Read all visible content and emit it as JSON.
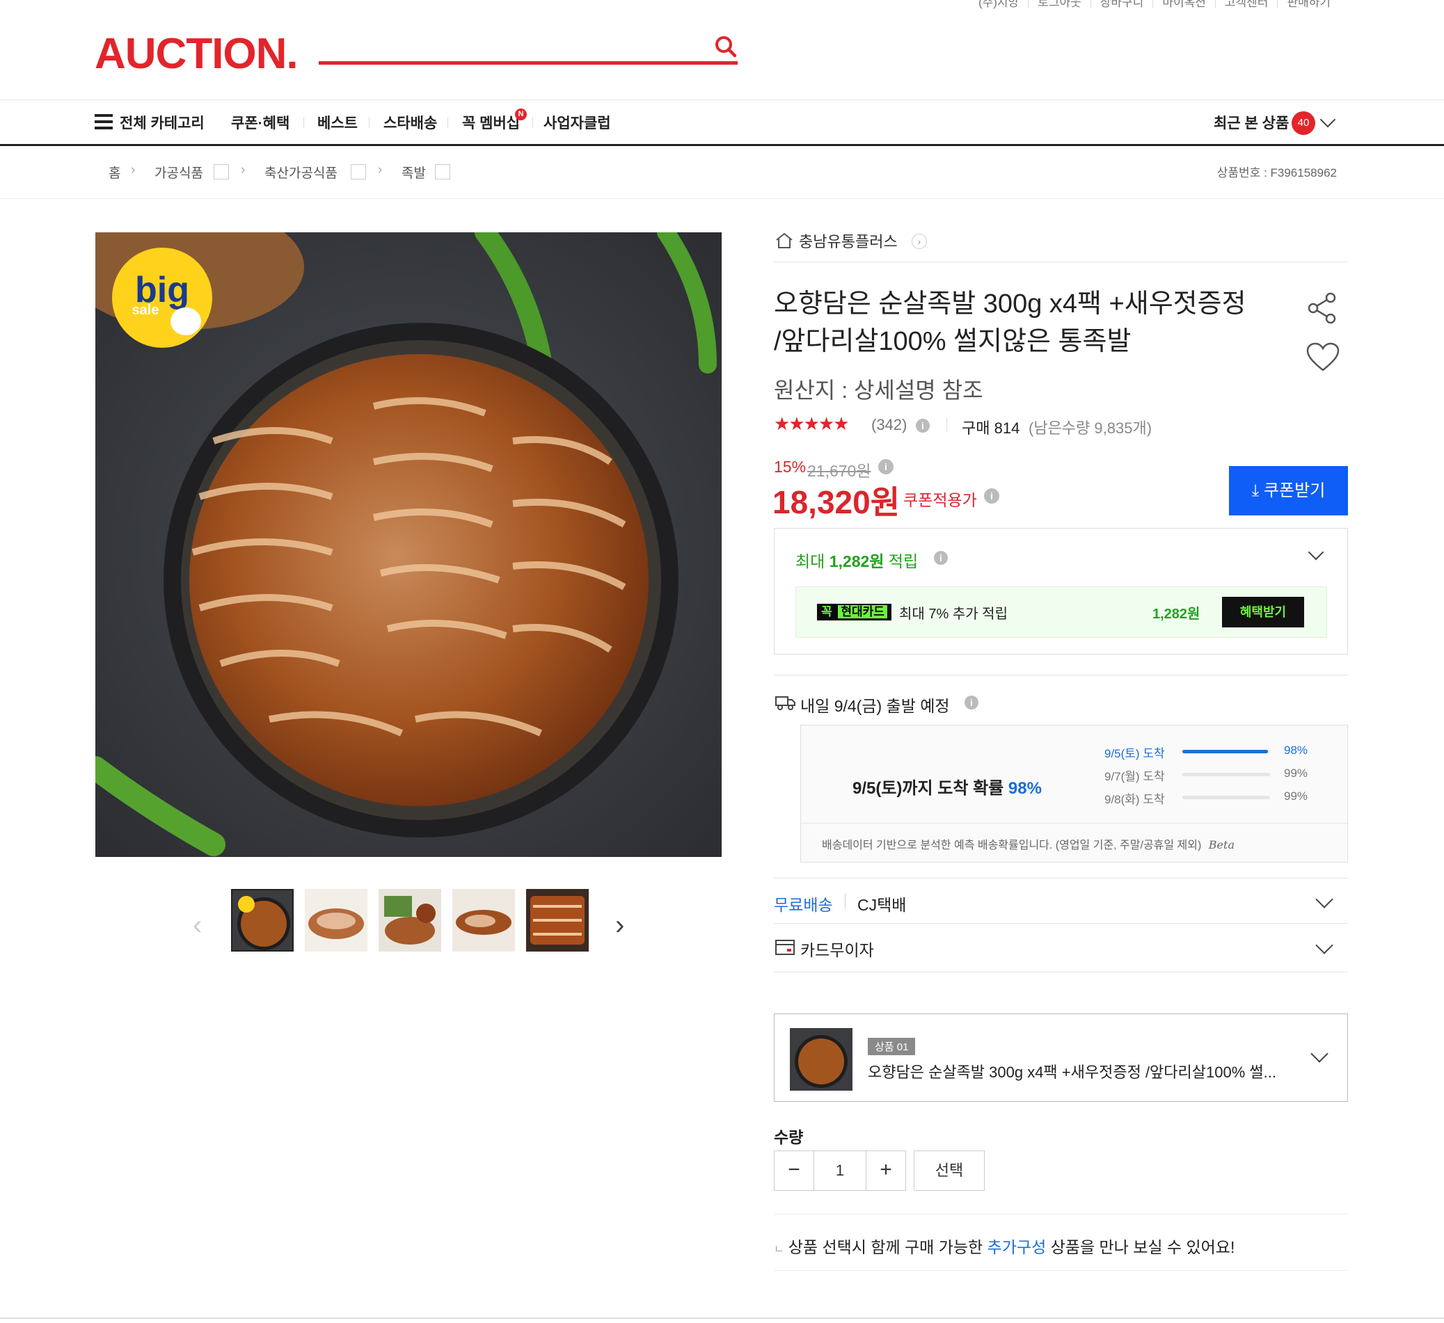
{
  "util_links": [
    "(주)지앙",
    "로그아웃",
    "장바구니",
    "마이옥션",
    "고객센터",
    "판매하기"
  ],
  "logo": "AUCTION.",
  "gnb": {
    "all_category": "전체 카테고리",
    "items": [
      "쿠폰·혜택",
      "베스트",
      "스타배송",
      "꼭 멤버십",
      "사업자클럽"
    ],
    "membership_badge": "N",
    "recent_label": "최근 본 상품",
    "recent_count": "40"
  },
  "breadcrumb": {
    "home": "홈",
    "levels": [
      "가공식품",
      "축산가공식품",
      "족발"
    ],
    "product_no": "상품번호 : F396158962"
  },
  "product": {
    "seller": "충남유통플러스",
    "title_line1": "오향담은 순살족발 300g x4팩 +새우젓증정",
    "title_line2": "/앞다리살100% 썰지않은 통족발",
    "origin": "원산지 : 상세설명 참조",
    "stars": "★★★★★",
    "review_count": "(342)",
    "purchase_label": "구매 814",
    "remaining": "(남은수량 9,835개)",
    "discount_rate": "15%",
    "original_price": "21,670원",
    "sale_price": "18,320원",
    "coupon_applied": "쿠폰적용가",
    "coupon_button": "쿠폰받기",
    "big_sale": "big",
    "big_sale_sub": "sale"
  },
  "reward": {
    "title_prefix": "최대 ",
    "amount": "1,282원",
    "title_suffix": " 적립",
    "card_badge_left": "꼭",
    "card_badge_right": "현대카드",
    "card_text": "최대 7% 추가 적립",
    "card_amount": "1,282원",
    "benefit_button": "혜택받기"
  },
  "delivery": {
    "dispatch": "내일 9/4(금) 출발 예정",
    "prob_prefix": "9/5(토)까지 도착 확률 ",
    "prob_value": "98%",
    "rows": [
      {
        "label": "9/5(토) 도착",
        "pct": "98%",
        "fill": 0.98,
        "highlight": true
      },
      {
        "label": "9/7(월) 도착",
        "pct": "99%",
        "fill": 0.0,
        "highlight": false
      },
      {
        "label": "9/8(화) 도착",
        "pct": "99%",
        "fill": 0.0,
        "highlight": false
      }
    ],
    "note": "배송데이터 기반으로 분석한 예측 배송확률입니다. (영업일 기준, 주말/공휴일 제외)",
    "beta": "Beta"
  },
  "shipping": {
    "free": "무료배송",
    "carrier": "CJ택배",
    "installment": "카드무이자"
  },
  "option": {
    "tag": "상품 01",
    "name": "오향담은 순살족발 300g x4팩 +새우젓증정 /앞다리살100% 썰..."
  },
  "quantity": {
    "label": "수량",
    "value": "1",
    "minus": "−",
    "plus": "+",
    "select": "선택"
  },
  "addon": {
    "prefix": "상품 선택시 함께 구매 가능한 ",
    "link": "추가구성",
    "suffix": " 상품을 만나 보실 수 있어요!"
  },
  "colors": {
    "brand_red": "#e3242b",
    "price_red": "#d9262c",
    "blue": "#0f5ef7",
    "green": "#22a21f"
  }
}
